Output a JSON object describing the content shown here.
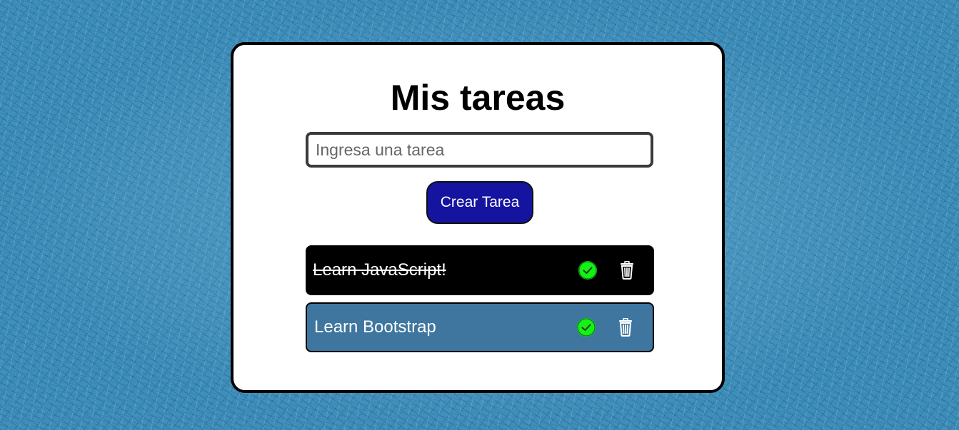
{
  "card": {
    "title": "Mis tareas"
  },
  "input": {
    "value": "",
    "placeholder": "Ingresa una tarea"
  },
  "create_button": {
    "label": "Crear Tarea"
  },
  "tasks": [
    {
      "text": "Learn JavaScript!",
      "completed": true,
      "background": "#000000"
    },
    {
      "text": "Learn Bootstrap",
      "completed": false,
      "background": "#3f76a0"
    }
  ],
  "icons": {
    "complete": "check-circle-icon",
    "delete": "trash-icon"
  },
  "colors": {
    "button": "#1414a0",
    "check": "#16f016",
    "page_background": "#3f8fbb"
  }
}
